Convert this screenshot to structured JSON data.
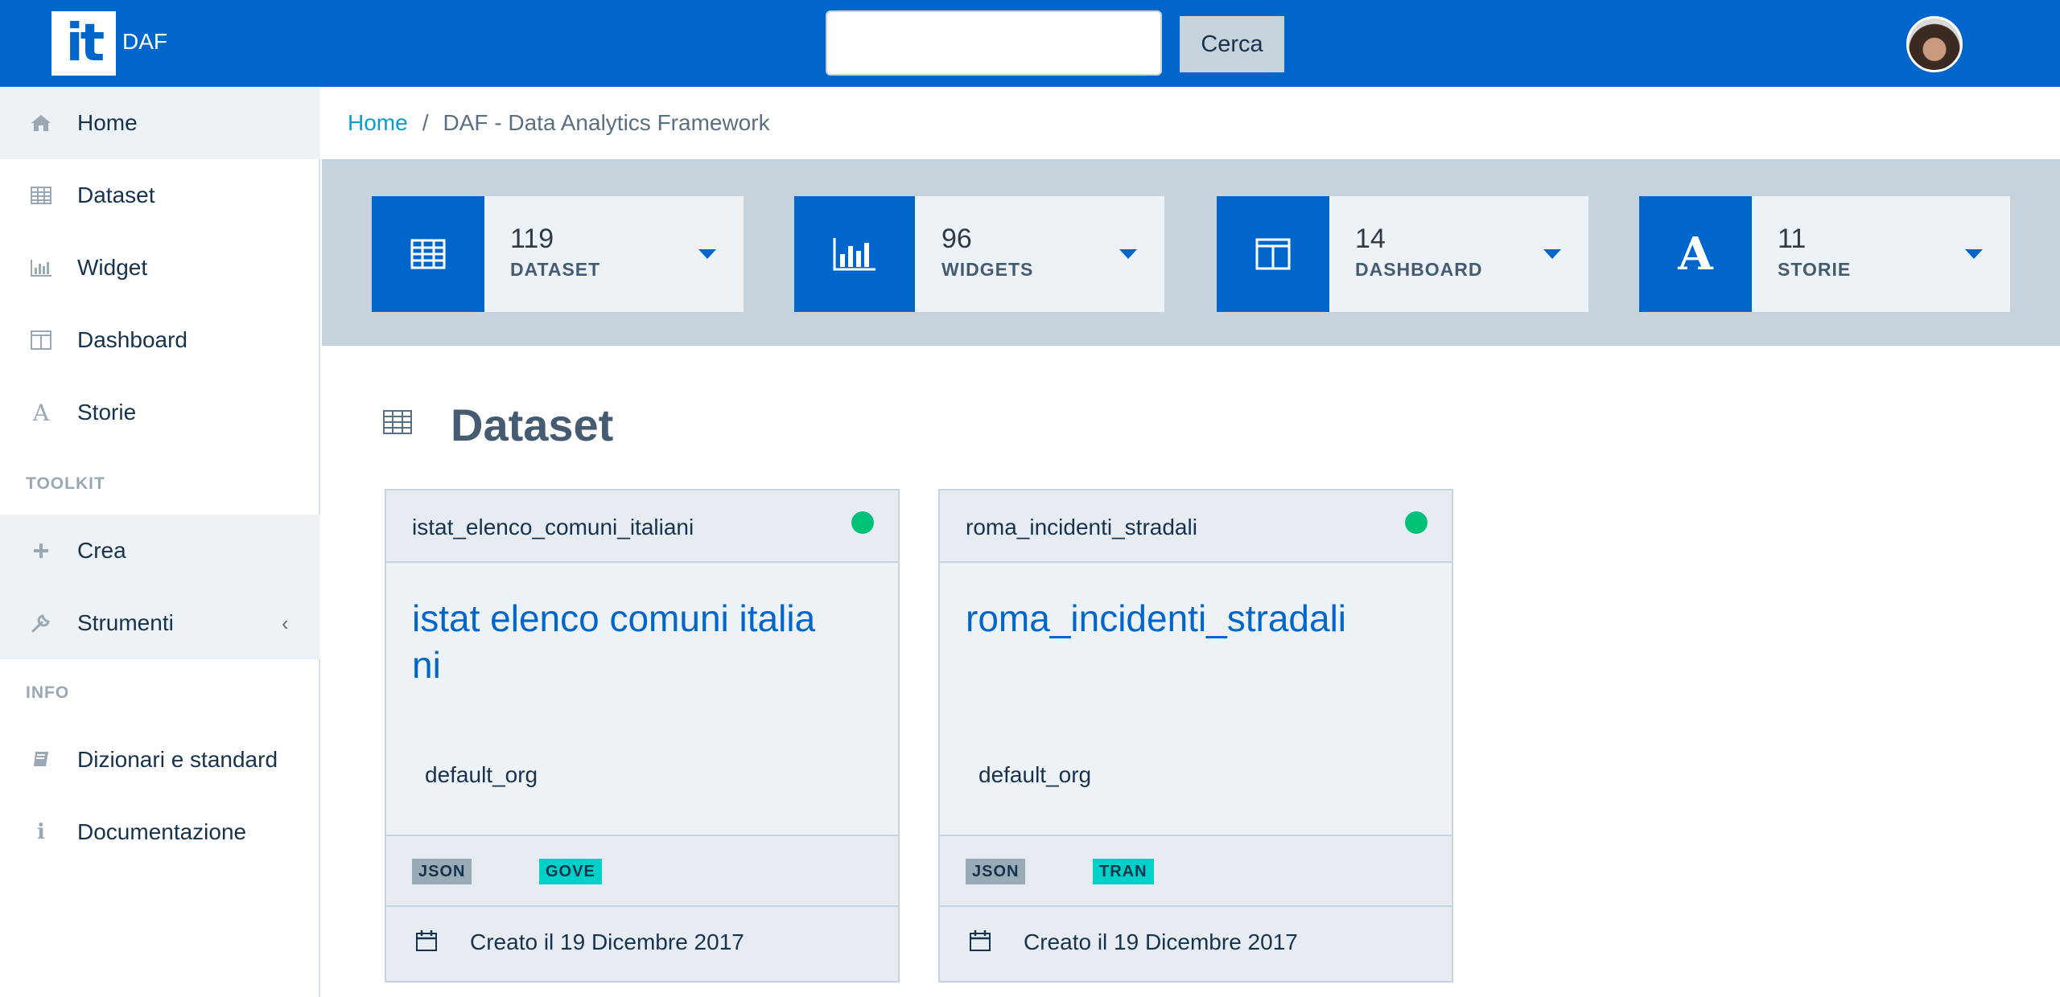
{
  "header": {
    "logo_glyph": "it",
    "logo_text": "DAF",
    "search_placeholder": "",
    "search_button": "Cerca"
  },
  "sidebar": {
    "items": [
      {
        "label": "Home",
        "icon": "home-icon"
      },
      {
        "label": "Dataset",
        "icon": "table-icon"
      },
      {
        "label": "Widget",
        "icon": "bar-chart-icon"
      },
      {
        "label": "Dashboard",
        "icon": "columns-icon"
      },
      {
        "label": "Storie",
        "icon": "font-icon"
      }
    ],
    "toolkit_label": "TOOLKIT",
    "toolkit_items": [
      {
        "label": "Crea",
        "icon": "plus-icon"
      },
      {
        "label": "Strumenti",
        "icon": "wrench-icon",
        "chevron": "‹"
      }
    ],
    "info_label": "INFO",
    "info_items": [
      {
        "label": "Dizionari e standard",
        "icon": "book-icon"
      },
      {
        "label": "Documentazione",
        "icon": "info-icon"
      }
    ]
  },
  "breadcrumb": {
    "home": "Home",
    "separator": "/",
    "current": "DAF - Data Analytics Framework"
  },
  "stats": [
    {
      "count": "119",
      "label": "DATASET",
      "icon": "table-icon"
    },
    {
      "count": "96",
      "label": "WIDGETS",
      "icon": "bar-chart-icon"
    },
    {
      "count": "14",
      "label": "DASHBOARD",
      "icon": "columns-icon"
    },
    {
      "count": "11",
      "label": "STORIE",
      "icon": "font-icon"
    }
  ],
  "section": {
    "title": "Dataset",
    "icon": "table-icon"
  },
  "cards": [
    {
      "slug": "istat_elenco_comuni_italiani",
      "title": "istat elenco comuni italiani",
      "org": "default_org",
      "format": "JSON",
      "theme": "GOVE",
      "created": "Creato il 19 Dicembre 2017",
      "status_color": "#00c176"
    },
    {
      "slug": "roma_incidenti_stradali",
      "title": "roma_incidenti_stradali",
      "org": "default_org",
      "format": "JSON",
      "theme": "TRAN",
      "created": "Creato il 19 Dicembre 2017",
      "status_color": "#00c176"
    }
  ],
  "colors": {
    "brand": "#0066cc",
    "band": "#c7d3dc",
    "status_ok": "#00c176",
    "theme_tag": "#00d1c8"
  }
}
